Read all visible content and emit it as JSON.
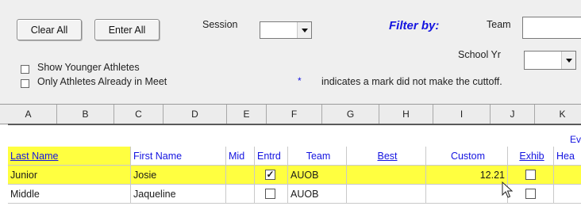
{
  "toolbar": {
    "clear_all_label": "Clear All",
    "enter_all_label": "Enter All"
  },
  "filters": {
    "session_label": "Session",
    "session_value": "",
    "filter_by_label": "Filter by:",
    "team_label": "Team",
    "team_value": "",
    "school_yr_label": "School Yr",
    "school_yr_value": ""
  },
  "options": {
    "show_younger_label": "Show Younger Athletes",
    "only_in_meet_label": "Only Athletes Already in Meet",
    "show_younger_checked": false,
    "only_in_meet_checked": false
  },
  "note": {
    "star": "*",
    "text": "indicates a mark did not make the cuttoff."
  },
  "sheet_columns": [
    "A",
    "B",
    "C",
    "D",
    "E",
    "F",
    "G",
    "H",
    "I",
    "J",
    "K"
  ],
  "band_label": "Ev",
  "table": {
    "headers": {
      "last_name": "Last Name",
      "first_name": "First Name",
      "mid": "Mid",
      "entrd": "Entrd",
      "team": "Team",
      "best": "Best",
      "custom": "Custom",
      "exhib": "Exhib",
      "hea": "Hea"
    },
    "rows": [
      {
        "last_name": "Junior",
        "first_name": "Josie",
        "mid": "",
        "entrd": true,
        "team": "AUOB",
        "best": "",
        "custom": "12.21",
        "exhib": false
      },
      {
        "last_name": "Middle",
        "first_name": "Jaqueline",
        "mid": "",
        "entrd": false,
        "team": "AUOB",
        "best": "",
        "custom": "",
        "exhib": false
      }
    ]
  }
}
